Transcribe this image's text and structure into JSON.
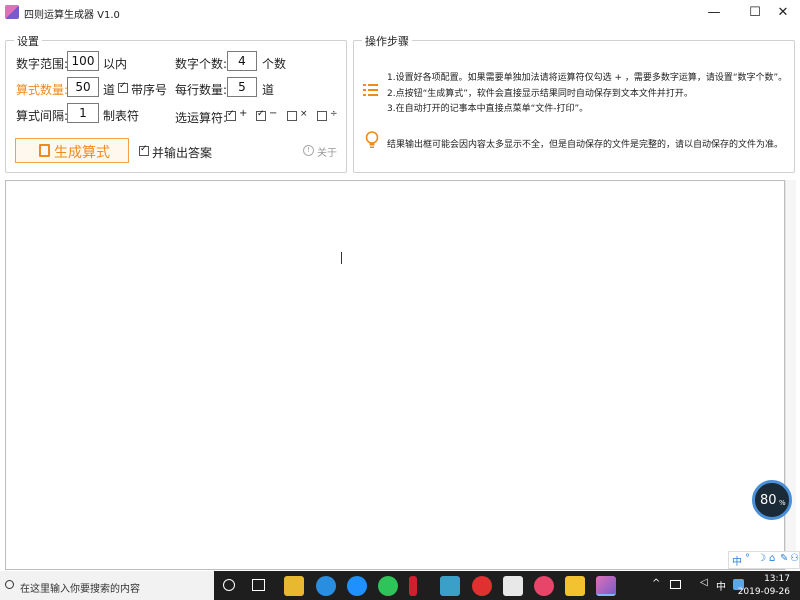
{
  "window": {
    "title": "四则运算生成器 V1.0",
    "minimize": "—",
    "maximize": "☐",
    "close": "✕"
  },
  "settings": {
    "legend": "设置",
    "range_label": "数字范围:",
    "range_value": "100",
    "range_unit": "以内",
    "count_label": "算式数量:",
    "count_value": "50",
    "count_unit": "道",
    "serial_label": "带序号",
    "serial_checked": true,
    "gap_label": "算式间隔:",
    "gap_value": "1",
    "gap_unit": "制表符",
    "digits_label": "数字个数:",
    "digits_value": "4",
    "digits_unit": "个数",
    "per_row_label": "每行数量:",
    "per_row_value": "5",
    "per_row_unit": "道",
    "ops_label": "选运算符:",
    "ops": [
      {
        "symbol": "+",
        "checked": true
      },
      {
        "symbol": "−",
        "checked": true
      },
      {
        "symbol": "×",
        "checked": false
      },
      {
        "symbol": "÷",
        "checked": false
      }
    ],
    "generate_label": "生成算式",
    "answers_label": "并输出答案",
    "answers_checked": true,
    "about_label": "关于"
  },
  "steps": {
    "legend": "操作步骤",
    "lines": [
      "1.设置好各项配置。如果需要单独加法请将运算符仅勾选 + ，需要多数字运算，请设置“数字个数”。",
      "2.点按钮“生成算式”，软件会直接显示结果同时自动保存到文本文件并打开。",
      "3.在自动打开的记事本中直接点菜单“文件-打印”。"
    ],
    "tip": "结果输出框可能会因内容太多显示不全，但是自动保存的文件是完整的，请以自动保存的文件为准。"
  },
  "output": {
    "text": ""
  },
  "widget": {
    "percent": "80",
    "unit": "%"
  },
  "tray": {
    "ime_items": [
      "中",
      "°",
      "☽",
      "⌂",
      "✎",
      "⚇"
    ]
  },
  "taskbar": {
    "search_placeholder": "在这里输入你要搜索的内容",
    "lang": "中",
    "time": "13:17",
    "date": "2019-09-26"
  },
  "colors": {
    "accent": "#f08a1e",
    "taskbar": "#1e1e1e"
  }
}
